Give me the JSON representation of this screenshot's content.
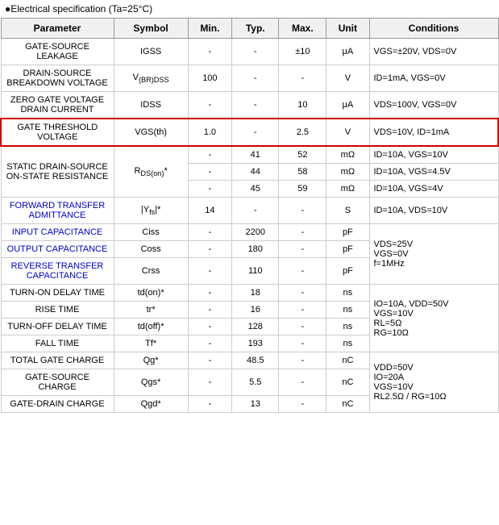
{
  "header": {
    "text": "●Electrical specification (Ta=25°C)"
  },
  "table": {
    "columns": [
      "Parameter",
      "Symbol",
      "Min.",
      "Typ.",
      "Max.",
      "Unit",
      "Conditions"
    ],
    "rows": [
      {
        "param": "GATE-SOURCE LEAKAGE",
        "symbol": "IGSS",
        "min": "-",
        "typ": "-",
        "max": "±10",
        "unit": "μA",
        "conditions": "VGS=±20V, VDS=0V",
        "highlight": false,
        "blue": false,
        "rowspan": 1
      },
      {
        "param": "DRAIN-SOURCE BREAKDOWN VOLTAGE",
        "symbol": "V(BR)DSS",
        "min": "100",
        "typ": "-",
        "max": "-",
        "unit": "V",
        "conditions": "ID=1mA, VGS=0V",
        "highlight": false,
        "blue": false
      },
      {
        "param": "ZERO GATE VOLTAGE DRAIN CURRENT",
        "symbol": "IDSS",
        "min": "-",
        "typ": "-",
        "max": "10",
        "unit": "μA",
        "conditions": "VDS=100V, VGS=0V",
        "highlight": false,
        "blue": false
      },
      {
        "param": "GATE THRESHOLD VOLTAGE",
        "symbol": "VGS(th)",
        "min": "1.0",
        "typ": "-",
        "max": "2.5",
        "unit": "V",
        "conditions": "VDS=10V, ID=1mA",
        "highlight": true,
        "blue": false
      },
      {
        "param": "STATIC DRAIN-SOURCE ON-STATE RESISTANCE",
        "symbol": "RDS(on)*",
        "min": "-",
        "typ": "-",
        "max": "-",
        "unit": "-",
        "conditions": "",
        "highlight": false,
        "blue": false,
        "multirow": true,
        "subrows": [
          {
            "min": "-",
            "typ": "41",
            "max": "52",
            "unit": "mΩ",
            "conditions": "ID=10A, VGS=10V"
          },
          {
            "min": "-",
            "typ": "44",
            "max": "58",
            "unit": "mΩ",
            "conditions": "ID=10A, VGS=4.5V"
          },
          {
            "min": "-",
            "typ": "45",
            "max": "59",
            "unit": "mΩ",
            "conditions": "ID=10A, VGS=4V"
          }
        ]
      },
      {
        "param": "FORWARD TRANSFER ADMITTANCE",
        "symbol": "|Yfs|*",
        "min": "14",
        "typ": "-",
        "max": "-",
        "unit": "S",
        "conditions": "ID=10A, VDS=10V",
        "highlight": false,
        "blue": true
      },
      {
        "param": "INPUT CAPACITANCE",
        "symbol": "Ciss",
        "min": "-",
        "typ": "2200",
        "max": "-",
        "unit": "pF",
        "conditions": "",
        "highlight": false,
        "blue": true,
        "sharedConditions": true
      },
      {
        "param": "OUTPUT CAPACITANCE",
        "symbol": "Coss",
        "min": "-",
        "typ": "180",
        "max": "-",
        "unit": "pF",
        "conditions": "",
        "highlight": false,
        "blue": true,
        "sharedConditions": true
      },
      {
        "param": "REVERSE TRANSFER CAPACITANCE",
        "symbol": "Crss",
        "min": "-",
        "typ": "110",
        "max": "-",
        "unit": "pF",
        "conditions": "",
        "highlight": false,
        "blue": true,
        "sharedConditions": true
      },
      {
        "param": "TURN-ON DELAY TIME",
        "symbol": "td(on)*",
        "min": "-",
        "typ": "18",
        "max": "-",
        "unit": "ns",
        "conditions": "",
        "highlight": false,
        "blue": false,
        "sharedConditions2": true
      },
      {
        "param": "RISE TIME",
        "symbol": "tr*",
        "min": "-",
        "typ": "16",
        "max": "-",
        "unit": "ns",
        "conditions": "",
        "highlight": false,
        "blue": false,
        "sharedConditions2": true
      },
      {
        "param": "TURN-OFF DELAY TIME",
        "symbol": "td(off)*",
        "min": "-",
        "typ": "128",
        "max": "-",
        "unit": "ns",
        "conditions": "",
        "highlight": false,
        "blue": false,
        "sharedConditions2": true
      },
      {
        "param": "FALL TIME",
        "symbol": "Tf*",
        "min": "-",
        "typ": "193",
        "max": "-",
        "unit": "ns",
        "conditions": "",
        "highlight": false,
        "blue": false,
        "sharedConditions2": true
      },
      {
        "param": "TOTAL GATE CHARGE",
        "symbol": "Qg*",
        "min": "-",
        "typ": "48.5",
        "max": "-",
        "unit": "nC",
        "conditions": "",
        "highlight": false,
        "blue": false,
        "sharedConditions3": true
      },
      {
        "param": "GATE-SOURCE CHARGE",
        "symbol": "Qgs*",
        "min": "-",
        "typ": "5.5",
        "max": "-",
        "unit": "nC",
        "conditions": "",
        "highlight": false,
        "blue": false,
        "sharedConditions3": true
      },
      {
        "param": "GATE-DRAIN CHARGE",
        "symbol": "Qgd*",
        "min": "-",
        "typ": "13",
        "max": "-",
        "unit": "nC",
        "conditions": "",
        "highlight": false,
        "blue": false,
        "sharedConditions3": true
      }
    ],
    "sharedCond1": "VDS=25V\nVGS=0V\nf=1MHz",
    "sharedCond2": "IO=10A, VDD=50V\nVGS=10V\nRL=5Ω\nRG=10Ω",
    "sharedCond3": "VDD=50V\nIO=20A\nVGS=10V\nRL2.5Ω / RG=10Ω"
  }
}
